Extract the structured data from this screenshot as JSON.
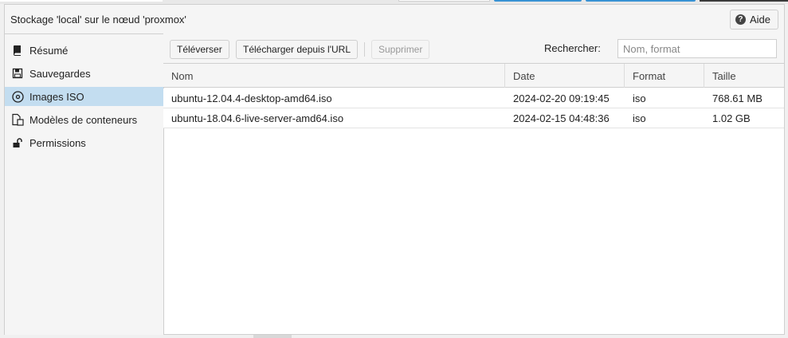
{
  "header": {
    "title": "Stockage 'local' sur le nœud 'proxmox'",
    "help_label": "Aide"
  },
  "sidebar": {
    "items": [
      {
        "label": "Résumé",
        "icon": "book-icon"
      },
      {
        "label": "Sauvegardes",
        "icon": "floppy-icon"
      },
      {
        "label": "Images ISO",
        "icon": "disc-icon",
        "selected": true
      },
      {
        "label": "Modèles de conteneurs",
        "icon": "container-template-icon"
      },
      {
        "label": "Permissions",
        "icon": "unlock-icon"
      }
    ]
  },
  "toolbar": {
    "upload_label": "Téléverser",
    "download_url_label": "Télécharger depuis l'URL",
    "delete_label": "Supprimer",
    "search_label": "Rechercher:",
    "search_placeholder": "Nom, format"
  },
  "table": {
    "columns": [
      "Nom",
      "Date",
      "Format",
      "Taille"
    ],
    "rows": [
      [
        "ubuntu-12.04.4-desktop-amd64.iso",
        "2024-02-20 09:19:45",
        "iso",
        "768.61 MB"
      ],
      [
        "ubuntu-18.04.6-live-server-amd64.iso",
        "2024-02-15 04:48:36",
        "iso",
        "1.02 GB"
      ]
    ]
  },
  "colors": {
    "selected_bg": "#c3ddf0",
    "accent": "#3892d4"
  }
}
